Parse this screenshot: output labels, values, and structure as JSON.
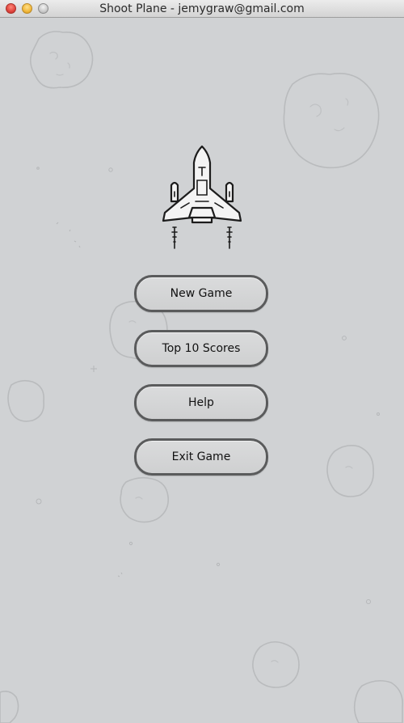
{
  "window": {
    "title": "Shoot Plane - jemygraw@gmail.com"
  },
  "menu": {
    "items": [
      {
        "label": "New Game"
      },
      {
        "label": "Top 10 Scores"
      },
      {
        "label": "Help"
      },
      {
        "label": "Exit Game"
      }
    ]
  },
  "icons": {
    "logo": "fighter-plane-icon",
    "background": "asteroid-doodles"
  },
  "colors": {
    "background": "#d0d2d4",
    "button_border": "#5a5b5c"
  }
}
